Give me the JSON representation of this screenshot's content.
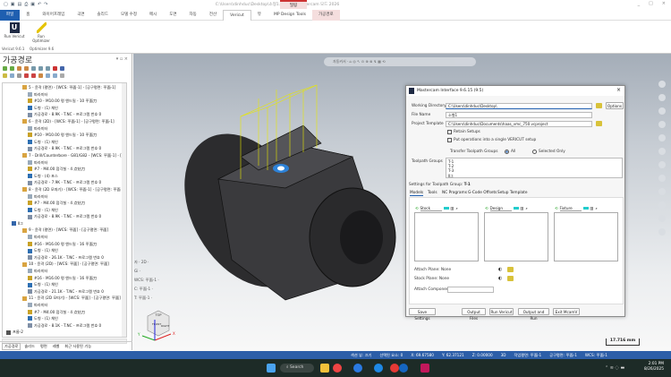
{
  "window": {
    "title": "C:\\Users\\dinhduc\\Desktop\\소형1.mcam - Mastercam 모드 2026",
    "context_group": "밀링",
    "controls": [
      "_",
      "□",
      "×"
    ]
  },
  "quick_access": [
    "new-icon",
    "save-icon",
    "open-icon",
    "print-icon",
    "save-as-icon",
    "undo-icon",
    "redo-icon"
  ],
  "ribbon": {
    "tabs": [
      "파일",
      "홈",
      "와이어프레임",
      "곡면",
      "솔리드",
      "모델 수정",
      "메시",
      "도면",
      "자동",
      "전산",
      "Vericut",
      "뷰",
      "MP Design Tools",
      "가공경로"
    ],
    "active_tab": "Vericut",
    "language": "기본",
    "buttons": [
      {
        "label": "Run Vericut",
        "group": "Vericut 9.6.1"
      },
      {
        "label": "Run Optimizer",
        "group": "Optimizer 9.6"
      }
    ]
  },
  "toolpath_panel": {
    "title": "가공경로",
    "tree": [
      {
        "level": 3,
        "icon": "op",
        "text": "5 - 윤곽 (평면) - [WCS: 平面-1] - [공구평면: 平面-1]"
      },
      {
        "level": 4,
        "icon": "param",
        "text": "파라미터"
      },
      {
        "level": 4,
        "icon": "tool",
        "text": "#10 - M10.00 평 엔드밀 - 10 平面刀"
      },
      {
        "level": 4,
        "icon": "geo",
        "text": "도형 - (1) 체인"
      },
      {
        "level": 4,
        "icon": "path",
        "text": "가공경로 - 8.9K - T.NC - 프로그램 번호 0"
      },
      {
        "level": 3,
        "icon": "op",
        "text": "6 - 윤곽 (2D) - [WCS: 平面-1] - [공구평면: 平面-1]"
      },
      {
        "level": 4,
        "icon": "param",
        "text": "파라미터"
      },
      {
        "level": 4,
        "icon": "tool",
        "text": "#10 - M10.00 평 엔드밀 - 10 平面刀"
      },
      {
        "level": 4,
        "icon": "geo",
        "text": "도형 - (1) 체인"
      },
      {
        "level": 4,
        "icon": "path",
        "text": "가공경로 - 8.9K - T.NC - 프로그램 번호 0"
      },
      {
        "level": 3,
        "icon": "op",
        "text": "7 - Drill/Counterbore - G81/G82 - [WCS: 平面-1] - [공구"
      },
      {
        "level": 4,
        "icon": "param",
        "text": "파라미터"
      },
      {
        "level": 4,
        "icon": "tool",
        "text": "#7 - M4.00 점각칠 - 4 点钻刀"
      },
      {
        "level": 4,
        "icon": "geo",
        "text": "도형 - (4) 포스"
      },
      {
        "level": 4,
        "icon": "path",
        "text": "가공경로 - 7.9K - T.NC - 프로그램 번호 0"
      },
      {
        "level": 3,
        "icon": "op",
        "text": "8 - 윤곽 (2D 모따기) - [WCS: 平面-1] - [공구평면: 平面"
      },
      {
        "level": 4,
        "icon": "param",
        "text": "파라미터"
      },
      {
        "level": 4,
        "icon": "tool",
        "text": "#7 - M4.00 점각칠 - 4 点钻刀"
      },
      {
        "level": 4,
        "icon": "geo",
        "text": "도형 - (1) 체인"
      },
      {
        "level": 4,
        "icon": "path",
        "text": "가공경로 - 8.9K - T.NC - 프로그램 번호 0"
      },
      {
        "level": 1,
        "icon": "group",
        "text": "Ⅱ그"
      },
      {
        "level": 3,
        "icon": "op",
        "text": "9 - 윤곽 (평면) - [WCS: 平面] - [공구평면: 平面]"
      },
      {
        "level": 4,
        "icon": "param",
        "text": "파라미터"
      },
      {
        "level": 4,
        "icon": "tool",
        "text": "#16 - M16.00 평 엔드밀 - 16 平面刀"
      },
      {
        "level": 4,
        "icon": "geo",
        "text": "도형 - (1) 체인"
      },
      {
        "level": 4,
        "icon": "path",
        "text": "가공경로 - 26.1K - T.NC - 프로그램 번호 0"
      },
      {
        "level": 3,
        "icon": "op",
        "text": "10 - 윤곽 (2D) - [WCS: 平面] - [공구평면: 平面]"
      },
      {
        "level": 4,
        "icon": "param",
        "text": "파라미터"
      },
      {
        "level": 4,
        "icon": "tool",
        "text": "#16 - M16.00 평 엔드밀 - 16 平面刀"
      },
      {
        "level": 4,
        "icon": "geo",
        "text": "도형 - (1) 체인"
      },
      {
        "level": 4,
        "icon": "path",
        "text": "가공경로 - 21.1K - T.NC - 프로그램 번호 0"
      },
      {
        "level": 3,
        "icon": "op",
        "text": "11 - 윤곽 (2D 모따기) - [WCS: 平面] - [공구평면: 平面]"
      },
      {
        "level": 4,
        "icon": "param",
        "text": "파라미터"
      },
      {
        "level": 4,
        "icon": "tool",
        "text": "#7 - M4.00 점각칠 - 4 点钻刀"
      },
      {
        "level": 4,
        "icon": "geo",
        "text": "도형 - (1) 체인"
      },
      {
        "level": 4,
        "icon": "path",
        "text": "가공경로 - 8.1K - T.NC - 프로그램 번호 0"
      },
      {
        "level": 0,
        "icon": "machine",
        "text": "프롬-2"
      },
      {
        "level": 1,
        "icon": "machine",
        "text": "속성 - 4 - AXIS VMC"
      },
      {
        "level": 2,
        "icon": "file",
        "text": "파일"
      },
      {
        "level": 2,
        "icon": "tool",
        "text": "리스트 공구"
      },
      {
        "level": 2,
        "icon": "stock",
        "text": "공작물 설정"
      },
      {
        "level": 2,
        "icon": "fixture",
        "text": "작업고정"
      }
    ],
    "bottom_tabs": [
      "가공경로",
      "솔리드",
      "평면",
      "레벨",
      "최근 사용된 기능"
    ]
  },
  "viewport": {
    "toolbar_label": "자동커서",
    "overlay": [
      "자 · 2D ·",
      "Gi ·",
      "WCS: 平面-1 ·",
      "C: 平面-1 ·",
      "T: 平面-1 ·"
    ],
    "view_cube": [
      "TOP",
      "FRONT",
      "RIGHT"
    ],
    "axes": [
      "X",
      "Y",
      "Z"
    ],
    "scale": "17.716 mm"
  },
  "dialog": {
    "title": "Mastercam Interface 9.6.15 (9.5)",
    "working_directory_label": "Working Directory",
    "working_directory": "C:\\Users\\dinhduc\\Desktop\\",
    "options": "Options",
    "file_name_label": "File Name",
    "file_name": "소형1",
    "project_template_label": "Project Template",
    "project_template": "C:\\Users\\dinhduc\\Documents\\haas_vmc_750.vcproject",
    "retain_setups": "Retain Setups",
    "single_setup": "Put operations into a single VERICUT setup",
    "transfer_label": "Transfer Toolpath Groups",
    "radio_all": "All",
    "radio_selected": "Selected Only",
    "toolpath_groups_label": "Toolpath Groups",
    "toolpath_groups": [
      "T-1",
      "T-2",
      "T-3",
      "Ⅱ그"
    ],
    "settings_label": "Settings for Toolpath Group:",
    "settings_group": "T-1",
    "tabs": [
      "Models",
      "Tools",
      "NC Programs",
      "G-Code Offsets",
      "Setup Template"
    ],
    "model_lists": [
      "Stock",
      "Design",
      "Fixture"
    ],
    "attach_plane": "Attach Plane: None",
    "stock_plane": "Stock Plane: None",
    "attach_component": "Attach Component",
    "buttons": {
      "save": "Save Settings",
      "output": "Output Files",
      "run": "Run Vericut",
      "output_run": "Output and Run",
      "exit": "Exit McamV"
    }
  },
  "status_bar": [
    "섹션 뷰: 끄기",
    "선택된 요소: 0",
    "X: 69.67580",
    "Y: 62.37121",
    "Z: 0.00000",
    "3D",
    "작업평면: 平面-1",
    "공구평면: 平面-1",
    "WCS: 平面-1"
  ],
  "taskbar": {
    "search": "Search",
    "time": "2:01 PM",
    "date": "8/26/2025"
  },
  "colors": {
    "accent": "#1f5fb0",
    "status_bar": "#2c5ea8",
    "taskbar": "#1d2b27",
    "part": "#2e2e30",
    "wire": "#e8e800"
  }
}
